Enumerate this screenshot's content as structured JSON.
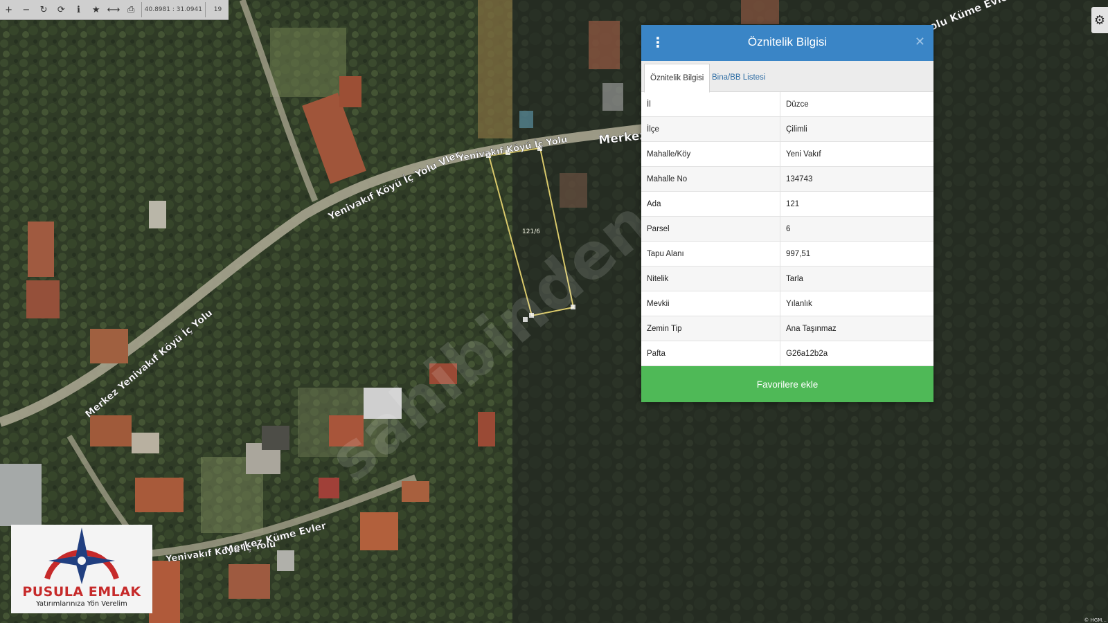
{
  "toolbar": {
    "buttons": [
      {
        "name": "zoom-in-button",
        "icon": "plus-icon",
        "glyph": "+"
      },
      {
        "name": "zoom-out-button",
        "icon": "minus-icon",
        "glyph": "−"
      },
      {
        "name": "refresh-button",
        "icon": "refresh-icon",
        "glyph": "↻"
      },
      {
        "name": "rotate-button",
        "icon": "rotate-icon",
        "glyph": "⟳"
      },
      {
        "name": "info-button",
        "icon": "info-icon",
        "glyph": "ℹ"
      },
      {
        "name": "favorite-button",
        "icon": "star-icon",
        "glyph": "★"
      },
      {
        "name": "measure-button",
        "icon": "arrows-horizontal-icon",
        "glyph": "⟷"
      },
      {
        "name": "print-button",
        "icon": "print-icon",
        "glyph": "⎙"
      }
    ],
    "coordinates": "40.8981 : 31.0941",
    "zoom_level": "19"
  },
  "settings": {
    "icon": "gear-icon",
    "glyph": "⚙"
  },
  "map": {
    "road_labels": [
      "Yenivakıf Köyü İç Yolu",
      "Yenivakıf Köyü İç Yolu Vler",
      "Merkez Yenivakıf Köyü İç Yolu",
      "Yenivakıf Köyü İç Yolu",
      "Merkez Küme Evler",
      "Merkez",
      "olu Küme Evler"
    ],
    "parcel_label": "121/6",
    "watermark": "sahibinden",
    "attribution": "© HGM..."
  },
  "panel": {
    "title": "Öznitelik Bilgisi",
    "menu_icon": "vertical-dots-icon",
    "close_icon": "close-icon",
    "tabs": [
      {
        "label": "Öznitelik Bilgisi",
        "active": true
      },
      {
        "label": "Bina/BB Listesi",
        "active": false
      }
    ],
    "rows": [
      {
        "key": "İl",
        "value": "Düzce"
      },
      {
        "key": "İlçe",
        "value": "Çilimli"
      },
      {
        "key": "Mahalle/Köy",
        "value": "Yeni Vakıf"
      },
      {
        "key": "Mahalle No",
        "value": "134743"
      },
      {
        "key": "Ada",
        "value": "121"
      },
      {
        "key": "Parsel",
        "value": "6"
      },
      {
        "key": "Tapu Alanı",
        "value": "997,51"
      },
      {
        "key": "Nitelik",
        "value": "Tarla"
      },
      {
        "key": "Mevkii",
        "value": "Yılanlık"
      },
      {
        "key": "Zemin Tip",
        "value": "Ana Taşınmaz"
      },
      {
        "key": "Pafta",
        "value": "G26a12b2a"
      }
    ],
    "favorite_button": "Favorilere ekle",
    "colors": {
      "header": "#3a85c6",
      "button": "#4fb957",
      "tab_link": "#2e6da4"
    }
  },
  "logo": {
    "name": "PUSULA EMLAK",
    "slogan": "Yatırımlarınıza Yön Verelim",
    "icon": "compass-star-icon"
  }
}
